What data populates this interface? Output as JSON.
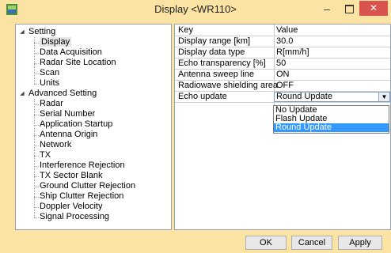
{
  "window": {
    "title": "Display <WR110>",
    "minimize_glyph": "–",
    "close_glyph": "✕"
  },
  "tree": {
    "groups": [
      {
        "label": "Setting",
        "items": [
          "Display",
          "Data Acquisition",
          "Radar Site Location",
          "Scan",
          "Units"
        ]
      },
      {
        "label": "Advanced Setting",
        "items": [
          "Radar",
          "Serial Number",
          "Application Startup",
          "Antenna Origin",
          "Network",
          "TX",
          "Interference Rejection",
          "TX Sector Blank",
          "Ground Clutter Rejection",
          "Ship Clutter Rejection",
          "Doppler Velocity",
          "Signal Processing"
        ]
      }
    ],
    "selected": "Display"
  },
  "table": {
    "header_key": "Key",
    "header_value": "Value",
    "rows": [
      {
        "key": "Display range [km]",
        "value": "30.0"
      },
      {
        "key": "Display data type",
        "value": "R[mm/h]"
      },
      {
        "key": "Echo transparency [%]",
        "value": "50"
      },
      {
        "key": "Antenna sweep line",
        "value": "ON"
      },
      {
        "key": "Radiowave shielding area",
        "value": "OFF"
      },
      {
        "key": "Echo update",
        "value": "Round Update"
      }
    ]
  },
  "dropdown": {
    "options": [
      "No Update",
      "Flash Update",
      "Round Update"
    ],
    "selected": "Round Update"
  },
  "buttons": {
    "ok": "OK",
    "cancel": "Cancel",
    "apply": "Apply"
  },
  "colors": {
    "title_bar": "#fbe3a4",
    "close_button": "#d9544d",
    "selection": "#3399ff"
  }
}
